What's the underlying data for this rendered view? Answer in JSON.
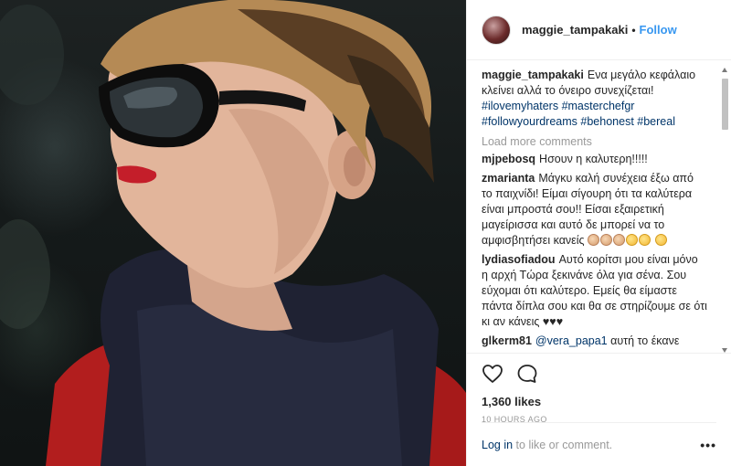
{
  "header": {
    "username": "maggie_tampakaki",
    "separator": "•",
    "follow_label": "Follow"
  },
  "caption": {
    "username": "maggie_tampakaki",
    "text": "Ενα μεγάλο κεφάλαιο κλείνει αλλά το όνειρο συνεχίζεται!",
    "tags": [
      "#ilovemyhaters",
      "#masterchefgr",
      "#followyourdreams",
      "#behonest",
      "#bereal"
    ]
  },
  "load_more_label": "Load more comments",
  "comments": [
    {
      "user": "mjpebosq",
      "text": "Ησουν η καλυτερη!!!!!"
    },
    {
      "user": "zmarianta",
      "text": "Μάγκυ καλή συνέχεια έξω από το παιχνίδι! Είμαι σίγουρη ότι τα καλύτερα είναι μπροστά σου!! Είσαι εξαιρετική μαγείρισσα και αυτό δε μπορεί να το αμφισβητήσει κανείς"
    },
    {
      "user": "lydiasofiadou",
      "text": "Αυτό κορίτσι μου είναι μόνο η αρχή Τώρα ξεκινάνε όλα για σένα. Σου εύχομαι ότι καλύτερο. Εμείς θα είμαστε πάντα δίπλα σου και θα σε στηρίζουμε σε ότι κι αν κάνεις ♥♥♥"
    },
    {
      "user": "glkerm81",
      "mention": "@vera_papa1",
      "text": "αυτή το έκανε"
    }
  ],
  "icons": {
    "like": "heart-icon",
    "comment": "comment-bubble-icon",
    "more": "more-options-icon"
  },
  "likes_text": "1,360 likes",
  "time_text": "10 HOURS AGO",
  "footer": {
    "login_label": "Log in",
    "rest_text": "to like or comment.",
    "more_label": "•••"
  }
}
